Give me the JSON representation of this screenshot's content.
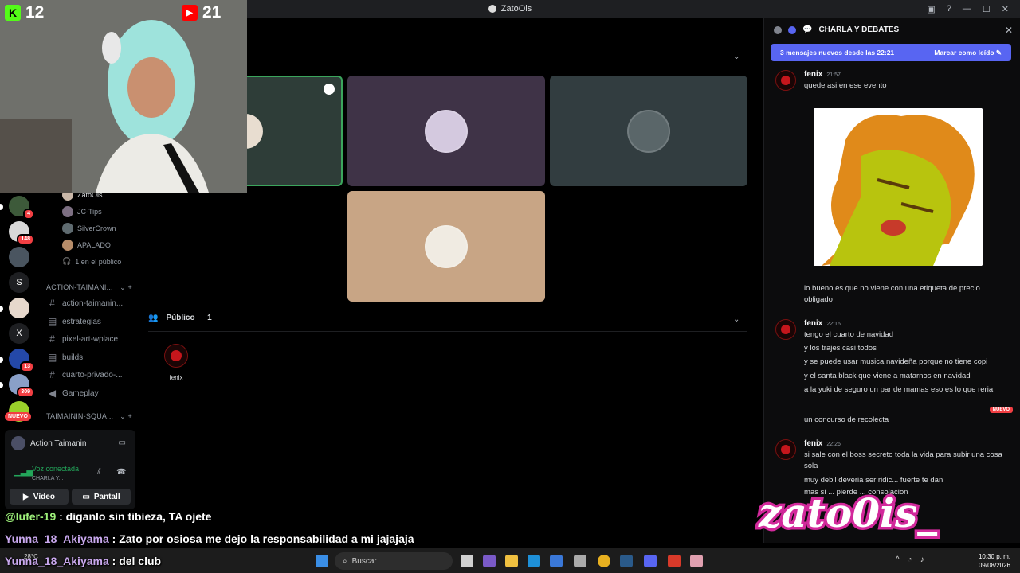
{
  "window": {
    "title": "ZatoOis"
  },
  "webcam": {
    "kick_count": "12",
    "youtube_count": "21"
  },
  "rail": {
    "badges": [
      "4",
      "148",
      "13",
      "309"
    ],
    "letter_servers": [
      "S",
      "X"
    ],
    "nuevo_label": "NUEVO"
  },
  "sidebar": {
    "voice_members": [
      "ZatoOis",
      "JC-Tips",
      "SilverCrown",
      "APALADO"
    ],
    "audience_count": "1 en el público",
    "category_1": "ACTION-TAIMANI...",
    "channels": [
      {
        "name": "action-taimanin...",
        "icon": "hash"
      },
      {
        "name": "estrategias",
        "icon": "forum"
      },
      {
        "name": "pixel-art-wplace",
        "icon": "hash"
      },
      {
        "name": "builds",
        "icon": "forum"
      },
      {
        "name": "cuarto-privado-...",
        "icon": "hash"
      },
      {
        "name": "Gameplay",
        "icon": "speaker"
      }
    ],
    "category_2": "TAIMAININ-SQUA..."
  },
  "voice_panel": {
    "server_name": "Action Taimanin",
    "status": "Voz conectada",
    "channel": "CHARLA Y...",
    "video_label": "Vídeo",
    "screen_label": "Pantall"
  },
  "stage": {
    "audience_header": "Público — 1",
    "audience_member": "fenix"
  },
  "chat": {
    "channel_title": "CHARLA Y DEBATES",
    "new_messages_text": "3 mensajes nuevos desde las 22:21",
    "mark_read": "Marcar como leído",
    "new_divider": "NUEVO",
    "groups": [
      {
        "author": "fenix",
        "time": "21:57",
        "lines": [
          "quede asi en ese evento"
        ]
      },
      {
        "author": "",
        "time": "",
        "lines": [
          "lo bueno es que no viene con una etiqueta de precio obligado"
        ]
      },
      {
        "author": "fenix",
        "time": "22:16",
        "lines": [
          "tengo el cuarto de navidad",
          "y los trajes casi todos",
          "y se puede usar musica navideña porque no tiene copi",
          "y el santa black que viene a matarnos en navidad",
          "a la yuki de seguro un par de mamas eso es lo que reria"
        ]
      },
      {
        "author": "",
        "time": "",
        "lines": [
          "un concurso de recolecta"
        ]
      },
      {
        "author": "fenix",
        "time": "22:26",
        "lines": [
          "si sale con el boss secreto toda la vida para subir una cosa sola",
          "muy debil deveria ser ridic... fuerte te dan",
          "mas si ... pierde ... consolacion"
        ]
      }
    ]
  },
  "stream_chat": [
    {
      "user": "@lufer-19",
      "text": ": diganlo sin tibieza, TA ojete"
    },
    {
      "user": "Yunna_18_Akiyama",
      "text": ": Zato por osiosa me dejo la responsabilidad a mi jajajaja"
    },
    {
      "user": "Yunna_18_Akiyama",
      "text": ": del club"
    }
  ],
  "brand_text": "zato0is_",
  "taskbar": {
    "weather": "28°C",
    "search": "Buscar",
    "time": "10:30 p. m.",
    "date": "09/08/2026"
  }
}
